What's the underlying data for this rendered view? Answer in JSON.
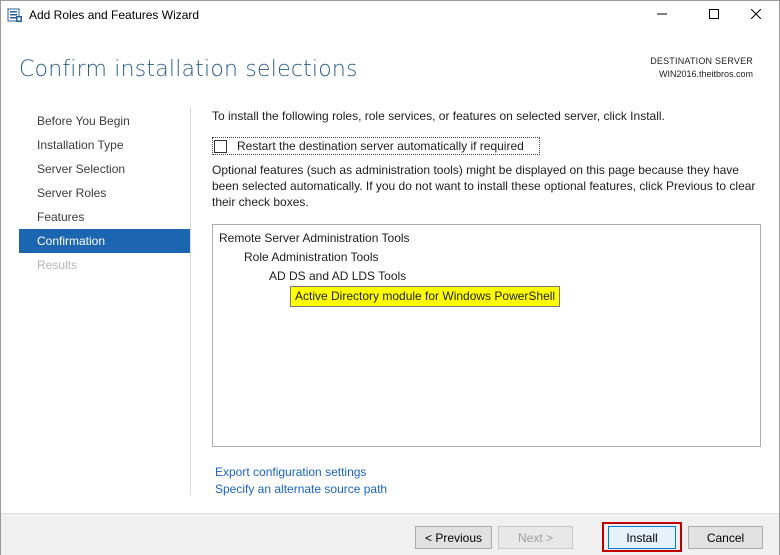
{
  "window": {
    "title": "Add Roles and Features Wizard",
    "icon": "server-manager-icon",
    "controls": {
      "minimize_icon": "minimize-icon",
      "maximize_icon": "maximize-icon",
      "close_icon": "close-icon"
    }
  },
  "header": {
    "page_title": "Confirm installation selections",
    "destination_label": "DESTINATION SERVER",
    "destination_server": "WIN2016.theitbros.com"
  },
  "nav": {
    "items": [
      {
        "label": "Before You Begin",
        "state": "normal"
      },
      {
        "label": "Installation Type",
        "state": "normal"
      },
      {
        "label": "Server Selection",
        "state": "normal"
      },
      {
        "label": "Server Roles",
        "state": "normal"
      },
      {
        "label": "Features",
        "state": "normal"
      },
      {
        "label": "Confirmation",
        "state": "active"
      },
      {
        "label": "Results",
        "state": "disabled"
      }
    ]
  },
  "main": {
    "intro": "To install the following roles, role services, or features on selected server, click Install.",
    "restart_checkbox": {
      "label": "Restart the destination server automatically if required",
      "checked": false
    },
    "optional_text": "Optional features (such as administration tools) might be displayed on this page because they have been selected automatically. If you do not want to install these optional features, click Previous to clear their check boxes.",
    "selections": [
      {
        "label": "Remote Server Administration Tools",
        "level": 0
      },
      {
        "label": "Role Administration Tools",
        "level": 1
      },
      {
        "label": "AD DS and AD LDS Tools",
        "level": 2
      },
      {
        "label": "Active Directory module for Windows PowerShell",
        "level": 3,
        "highlighted": true
      }
    ],
    "links": {
      "export": "Export configuration settings",
      "alternate_source": "Specify an alternate source path"
    }
  },
  "footer": {
    "previous_label": "< Previous",
    "next_label": "Next >",
    "install_label": "Install",
    "cancel_label": "Cancel"
  },
  "colors": {
    "accent": "#1c65b1",
    "title": "#2b5d8a",
    "link": "#1a63c4",
    "highlight": "#ffff00",
    "annotation": "#c00000"
  }
}
